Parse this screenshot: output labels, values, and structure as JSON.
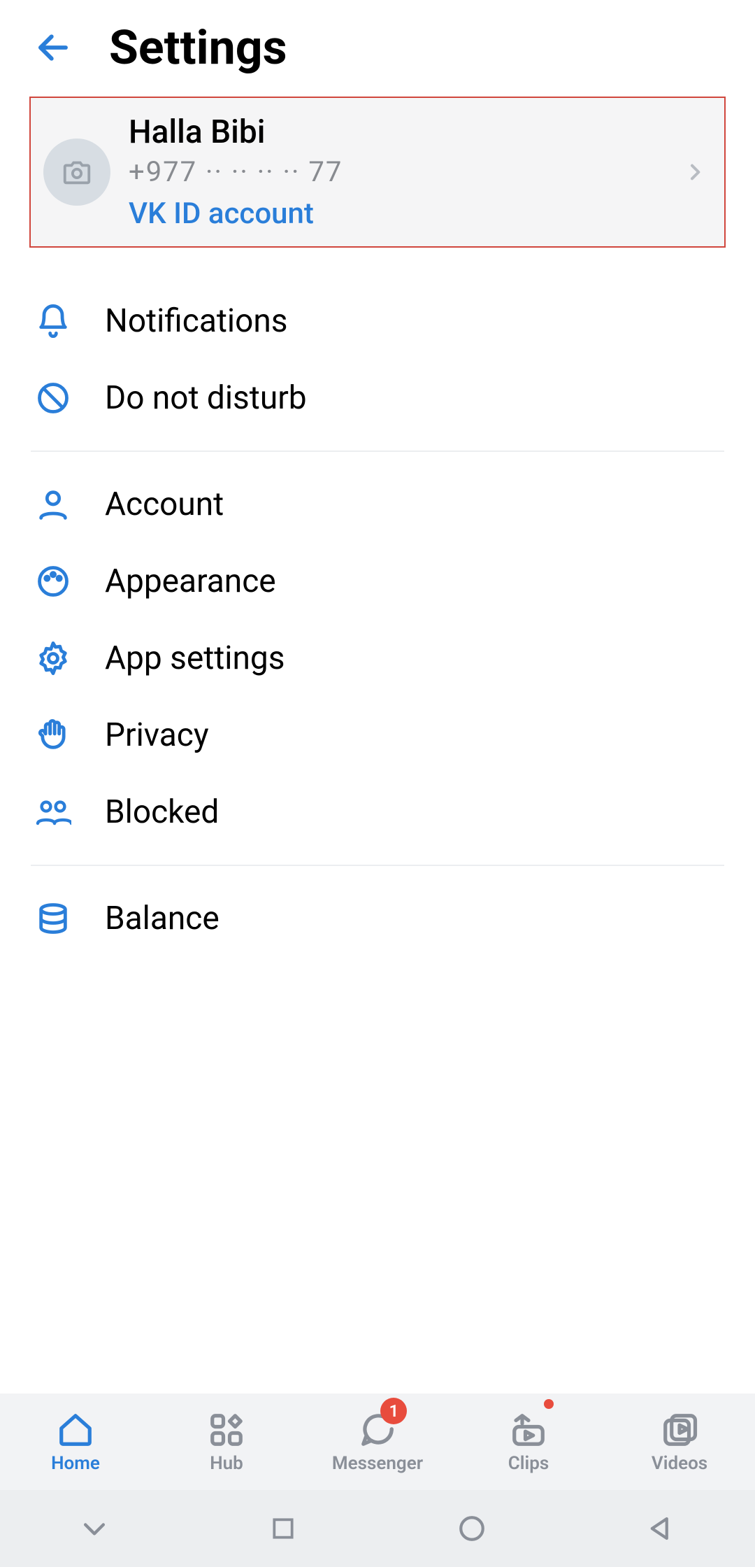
{
  "header": {
    "title": "Settings"
  },
  "profile": {
    "name": "Halla Bibi",
    "phone": "+977  ·· ·· ·· ·· 77",
    "vkid_label": "VK ID account"
  },
  "sections": {
    "group1": [
      {
        "icon": "bell",
        "label": "Notifications"
      },
      {
        "icon": "nosign",
        "label": "Do not disturb"
      }
    ],
    "group2": [
      {
        "icon": "person",
        "label": "Account"
      },
      {
        "icon": "palette",
        "label": "Appearance"
      },
      {
        "icon": "gear",
        "label": "App settings"
      },
      {
        "icon": "hand",
        "label": "Privacy"
      },
      {
        "icon": "people",
        "label": "Blocked"
      }
    ],
    "group3": [
      {
        "icon": "coins",
        "label": "Balance"
      }
    ]
  },
  "bottomnav": {
    "home": "Home",
    "hub": "Hub",
    "messenger": "Messenger",
    "clips": "Clips",
    "videos": "Videos",
    "messenger_badge": "1"
  },
  "colors": {
    "accent": "#2a7ed9",
    "highlight_border": "#d0463d",
    "icon_blue": "#2a7ed9",
    "badge_red": "#e84c3d"
  }
}
